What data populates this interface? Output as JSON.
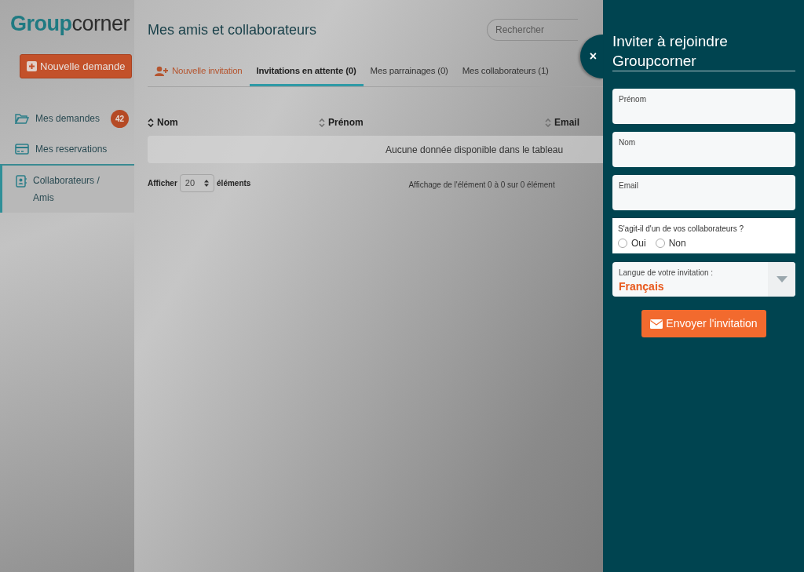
{
  "logo": "**Group**corner",
  "new_request_button": "Nouvelle demande",
  "sidebar": {
    "items": [
      {
        "label": "Mes demandes",
        "kind": "folder",
        "badge": "42",
        "selected": false
      },
      {
        "label": "Mes reservations",
        "kind": "card",
        "selected": false
      },
      {
        "label": "Collaborateurs / Amis",
        "kind": "contact",
        "selected": true
      }
    ]
  },
  "page_title": "Mes amis et collaborateurs",
  "search": {
    "placeholder": "Rechercher"
  },
  "tabs": [
    {
      "label": "Nouvelle invitation",
      "kind": "action",
      "selected": false
    },
    {
      "label": "Invitations en attente (0)",
      "kind": "tab",
      "selected": true
    },
    {
      "label": "Mes parrainages (0)",
      "kind": "tab",
      "selected": false
    },
    {
      "label": "Mes collaborateurs (1)",
      "kind": "tab",
      "selected": false
    }
  ],
  "table": {
    "columns": [
      {
        "label": "Nom",
        "sorted": true
      },
      {
        "label": "Prénom",
        "sorted": false
      },
      {
        "label": "Email",
        "sorted": false
      }
    ],
    "empty_message": "Aucune donnée disponible dans le tableau"
  },
  "length_menu": {
    "label": "Afficher",
    "value": "20",
    "suffix": "éléments"
  },
  "table_info": "Affichage de l'élément 0 à 0 sur 0 élément",
  "panel": {
    "close": "×",
    "title": "Inviter à rejoindre Groupcorner",
    "fields": [
      {
        "label": "Prénom"
      },
      {
        "label": "Nom"
      },
      {
        "label": "Email"
      }
    ],
    "question": {
      "label": "S'agit-il d'un de vos collaborateurs ?",
      "options": [
        {
          "label": "Oui",
          "selected": false
        },
        {
          "label": "Non",
          "selected": false
        }
      ]
    },
    "language": {
      "label": "Langue de votre invitation :",
      "value": "Français"
    },
    "submit": "Envoyer l'invitation"
  }
}
